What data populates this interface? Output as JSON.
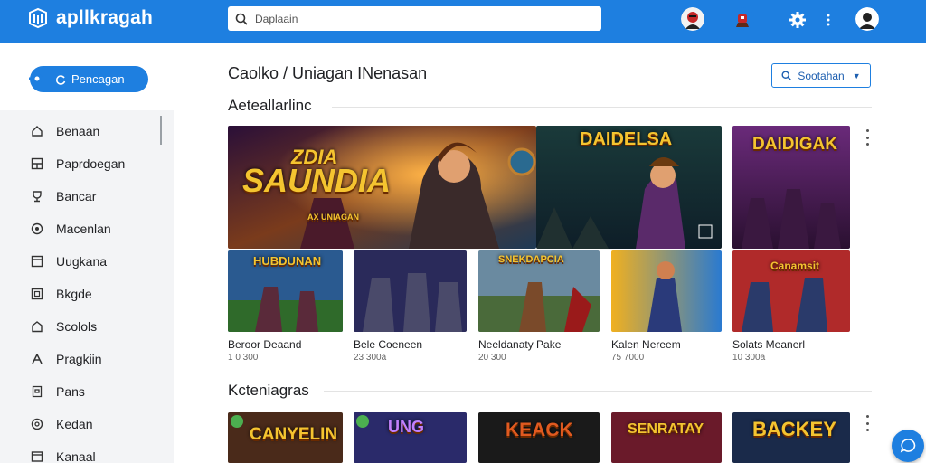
{
  "app": {
    "title": "apllkragah"
  },
  "search": {
    "placeholder": "Daplaain"
  },
  "sidebar": {
    "primary_button": "Pencagan",
    "items": [
      {
        "label": "Benaan",
        "icon": "home-icon"
      },
      {
        "label": "Paprdoegan",
        "icon": "grid-icon"
      },
      {
        "label": "Bancar",
        "icon": "trophy-icon"
      },
      {
        "label": "Macenlan",
        "icon": "clock-icon"
      },
      {
        "label": "Uugkana",
        "icon": "box-icon"
      },
      {
        "label": "Bkgde",
        "icon": "puzzle-icon"
      },
      {
        "label": "Scolols",
        "icon": "house-icon"
      },
      {
        "label": "Pragkiin",
        "icon": "person-icon"
      },
      {
        "label": "Pans",
        "icon": "shield-icon"
      },
      {
        "label": "Kedan",
        "icon": "target-icon"
      },
      {
        "label": "Kanaal",
        "icon": "folder-icon"
      }
    ]
  },
  "main": {
    "breadcrumb": "Caolko / Uniagan INenasan",
    "sort_label": "Sootahan",
    "section1": {
      "title": "Aeteallarlinc"
    },
    "section2": {
      "title": "Kcteniagras"
    },
    "featured": [
      {
        "title": "SAUNDIA",
        "subtitle": "ZDIA",
        "tag": "AX UNIAGAN"
      },
      {
        "title": "DAIDELSA",
        "subtitle": ""
      },
      {
        "title": "DAIDIGAK",
        "subtitle": ""
      }
    ],
    "games": [
      {
        "thumb_title": "HUBDUNAN",
        "name": "Beroor Deaand",
        "meta": "1 0 300"
      },
      {
        "thumb_title": "",
        "name": "Bele Coeneen",
        "meta": "23 300a"
      },
      {
        "thumb_title": "SNEKDAPCIA",
        "name": "Neeldanaty Pake",
        "meta": "20 300"
      },
      {
        "thumb_title": "",
        "name": "Kalen Nereem",
        "meta": "75 7000"
      },
      {
        "thumb_title": "Canamsit",
        "name": "Solats Meanerl",
        "meta": "10 300a"
      }
    ],
    "category_tiles": [
      {
        "title": "CANYELIN"
      },
      {
        "title": "UNG"
      },
      {
        "title": "KEACK"
      },
      {
        "title": "SENRATAY"
      },
      {
        "title": "BACKEY"
      }
    ]
  },
  "colors": {
    "accent": "#1e7fe0",
    "title_gold": "#f4c430"
  }
}
